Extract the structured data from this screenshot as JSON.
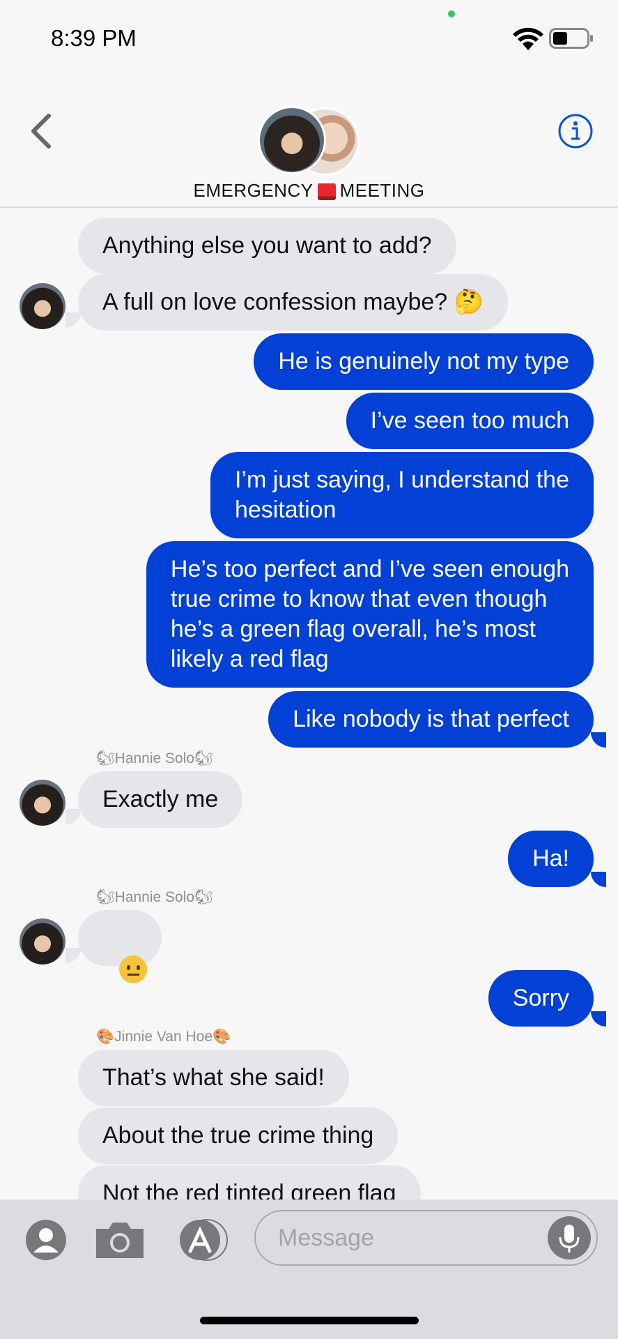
{
  "status_bar": {
    "time": "8:39 PM"
  },
  "header": {
    "title_left": "EMERGENCY",
    "title_right": "MEETING"
  },
  "messages": [
    {
      "text": "Anything else you want to add?"
    },
    {
      "text": "A full on love confession maybe? 🤔"
    },
    {
      "text": "He is genuinely not my type"
    },
    {
      "text": "I’ve seen too much"
    },
    {
      "text": "I’m just saying, I understand the\nhesitation"
    },
    {
      "text": "He’s too perfect and I’ve seen enough\ntrue crime to know that even though\nhe’s a green flag overall, he’s most\nlikely a red flag"
    },
    {
      "text": "Like nobody is that perfect"
    },
    {
      "sender": "🐿Hannie Solo🐿"
    },
    {
      "text": "Exactly me"
    },
    {
      "text": "Ha!"
    },
    {
      "sender": "🐿Hannie Solo🐿"
    },
    {
      "emoji": "neutral-face"
    },
    {
      "text": "Sorry"
    },
    {
      "sender": "🎨Jinnie Van Hoe🎨"
    },
    {
      "text": "That’s what she said!"
    },
    {
      "text": "About the true crime thing"
    },
    {
      "text": "Not the red tinted green flag"
    }
  ],
  "input_bar": {
    "placeholder": "Message"
  },
  "colors": {
    "outgoing": "#0240d6",
    "incoming": "#e6e5ea",
    "accent": "#0a52d6"
  }
}
